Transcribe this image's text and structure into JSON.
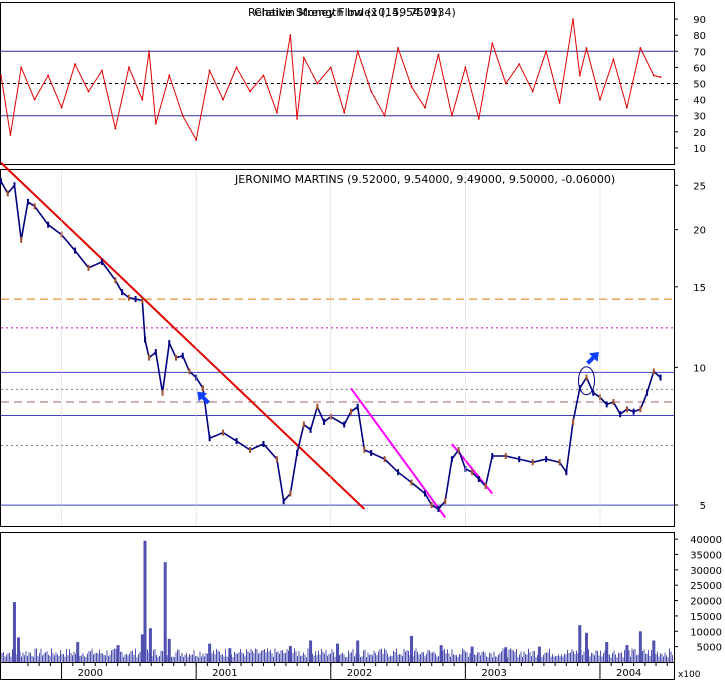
{
  "chart_data": [
    {
      "type": "line",
      "panel": "rsi",
      "title_overlay": [
        "Relative Strength Index (14, 54.7934)",
        "Chaikin Money Flow (10, 59.7501)"
      ],
      "ylim": [
        0,
        100
      ],
      "yticks": [
        10,
        20,
        30,
        40,
        50,
        60,
        70,
        80,
        90
      ],
      "levels": {
        "upper": 70,
        "middle": 50,
        "lower": 30
      },
      "series": [
        {
          "color": "#e00000",
          "x": [
            1999.55,
            1999.62,
            1999.7,
            1999.8,
            1999.9,
            2000.0,
            2000.1,
            2000.2,
            2000.3,
            2000.4,
            2000.5,
            2000.6,
            2000.65,
            2000.7,
            2000.8,
            2000.9,
            2001.0,
            2001.1,
            2001.2,
            2001.3,
            2001.4,
            2001.5,
            2001.6,
            2001.7,
            2001.75,
            2001.8,
            2001.9,
            2002.0,
            2002.1,
            2002.2,
            2002.3,
            2002.4,
            2002.5,
            2002.6,
            2002.7,
            2002.8,
            2002.9,
            2003.0,
            2003.1,
            2003.2,
            2003.3,
            2003.4,
            2003.5,
            2003.6,
            2003.7,
            2003.8,
            2003.85,
            2003.9,
            2004.0,
            2004.1,
            2004.2,
            2004.3,
            2004.4,
            2004.45
          ],
          "values": [
            55,
            18,
            60,
            40,
            55,
            35,
            62,
            45,
            58,
            22,
            60,
            40,
            70,
            25,
            55,
            30,
            15,
            58,
            40,
            60,
            45,
            55,
            32,
            80,
            28,
            66,
            50,
            60,
            32,
            70,
            45,
            30,
            72,
            48,
            35,
            68,
            30,
            60,
            28,
            75,
            50,
            62,
            45,
            70,
            38,
            90,
            55,
            72,
            40,
            65,
            35,
            72,
            55,
            54
          ]
        }
      ]
    },
    {
      "type": "line",
      "panel": "price",
      "title": "JERONIMO MARTINS (9.52000, 9.54000, 9.49000, 9.50000, -0.06000)",
      "scale": "log",
      "ylim": [
        4.5,
        27
      ],
      "yticks": [
        5,
        10,
        15,
        20,
        25
      ],
      "hlines": [
        {
          "y": 14.1,
          "style": "dashed",
          "color": "#e07a00"
        },
        {
          "y": 12.2,
          "style": "dotted",
          "color": "#c000c0"
        },
        {
          "y": 9.75,
          "style": "solid",
          "color": "#4040c0"
        },
        {
          "y": 8.95,
          "style": "dotted",
          "color": "#808080"
        },
        {
          "y": 8.4,
          "style": "dashed",
          "color": "#a06060"
        },
        {
          "y": 7.85,
          "style": "solid",
          "color": "#4040c0"
        },
        {
          "y": 6.75,
          "style": "dotted",
          "color": "#808080"
        },
        {
          "y": 5.0,
          "style": "solid",
          "color": "#4040c0"
        }
      ],
      "trendlines": [
        {
          "color": "#e00000",
          "from": [
            1999.55,
            28.0
          ],
          "to": [
            2002.25,
            4.9
          ]
        },
        {
          "color": "#ff00ff",
          "from": [
            2002.15,
            9.0
          ],
          "to": [
            2002.85,
            4.7
          ]
        },
        {
          "color": "#ff00ff",
          "from": [
            2002.9,
            6.8
          ],
          "to": [
            2003.2,
            5.3
          ]
        }
      ],
      "series": [
        {
          "color": "#000080",
          "x": [
            1999.55,
            1999.6,
            1999.65,
            1999.7,
            1999.75,
            1999.8,
            1999.9,
            2000.0,
            2000.1,
            2000.2,
            2000.3,
            2000.4,
            2000.45,
            2000.5,
            2000.55,
            2000.6,
            2000.62,
            2000.65,
            2000.7,
            2000.75,
            2000.8,
            2000.85,
            2000.9,
            2000.95,
            2001.0,
            2001.05,
            2001.1,
            2001.2,
            2001.3,
            2001.4,
            2001.5,
            2001.6,
            2001.65,
            2001.7,
            2001.75,
            2001.8,
            2001.85,
            2001.9,
            2001.95,
            2002.0,
            2002.1,
            2002.15,
            2002.2,
            2002.25,
            2002.3,
            2002.4,
            2002.5,
            2002.6,
            2002.7,
            2002.75,
            2002.8,
            2002.85,
            2002.9,
            2002.95,
            2003.0,
            2003.05,
            2003.1,
            2003.15,
            2003.2,
            2003.3,
            2003.4,
            2003.5,
            2003.6,
            2003.7,
            2003.75,
            2003.8,
            2003.85,
            2003.9,
            2003.95,
            2004.0,
            2004.05,
            2004.1,
            2004.15,
            2004.2,
            2004.25,
            2004.3,
            2004.35,
            2004.4,
            2004.45
          ],
          "values": [
            25.5,
            24.0,
            25.0,
            19.0,
            23.0,
            22.5,
            20.5,
            19.5,
            18.0,
            16.5,
            17.0,
            15.5,
            14.6,
            14.2,
            14.1,
            14.0,
            11.5,
            10.5,
            10.8,
            8.8,
            11.3,
            10.5,
            10.6,
            9.8,
            9.5,
            9.0,
            7.0,
            7.2,
            6.9,
            6.6,
            6.8,
            6.3,
            5.1,
            5.3,
            6.5,
            7.5,
            7.3,
            8.2,
            7.6,
            7.8,
            7.5,
            8.0,
            8.2,
            6.6,
            6.5,
            6.3,
            5.9,
            5.6,
            5.3,
            5.0,
            4.9,
            5.1,
            6.3,
            6.6,
            6.0,
            5.9,
            5.7,
            5.5,
            6.4,
            6.4,
            6.3,
            6.2,
            6.3,
            6.2,
            5.9,
            7.6,
            9.0,
            9.5,
            8.8,
            8.6,
            8.3,
            8.4,
            7.9,
            8.1,
            8.0,
            8.1,
            8.8,
            9.8,
            9.5
          ]
        }
      ],
      "annotations": [
        {
          "type": "arrow",
          "x": 2001.05,
          "y": 8.6,
          "color": "#1040ff"
        },
        {
          "type": "arrow",
          "x": 2003.95,
          "y": 10.5,
          "color": "#1040ff"
        },
        {
          "type": "ellipse",
          "x": 2003.9,
          "y": 9.35,
          "color": "#000080"
        }
      ]
    },
    {
      "type": "bar",
      "panel": "volume",
      "ylim": [
        0,
        42000
      ],
      "yticks": [
        5000,
        10000,
        15000,
        20000,
        25000,
        30000,
        35000,
        40000
      ],
      "ytick_labels": [
        "5000",
        "10000",
        "15000",
        "20000",
        "25000",
        "30000",
        "35000",
        "40000"
      ],
      "unit_label": "x100",
      "color": "#5050b0",
      "spikes": [
        {
          "x": 1999.65,
          "value": 19500
        },
        {
          "x": 1999.68,
          "value": 8000
        },
        {
          "x": 2000.12,
          "value": 6500
        },
        {
          "x": 2000.42,
          "value": 5500
        },
        {
          "x": 2000.6,
          "value": 9000
        },
        {
          "x": 2000.62,
          "value": 39500
        },
        {
          "x": 2000.66,
          "value": 11000
        },
        {
          "x": 2000.77,
          "value": 32500
        },
        {
          "x": 2000.8,
          "value": 7500
        },
        {
          "x": 2001.1,
          "value": 6000
        },
        {
          "x": 2001.25,
          "value": 4500
        },
        {
          "x": 2001.7,
          "value": 5200
        },
        {
          "x": 2001.85,
          "value": 7000
        },
        {
          "x": 2002.05,
          "value": 6000
        },
        {
          "x": 2002.2,
          "value": 7000
        },
        {
          "x": 2002.6,
          "value": 8500
        },
        {
          "x": 2002.82,
          "value": 5500
        },
        {
          "x": 2003.05,
          "value": 5000
        },
        {
          "x": 2003.3,
          "value": 4800
        },
        {
          "x": 2003.55,
          "value": 5000
        },
        {
          "x": 2003.85,
          "value": 12000
        },
        {
          "x": 2003.9,
          "value": 9500
        },
        {
          "x": 2004.05,
          "value": 6500
        },
        {
          "x": 2004.2,
          "value": 5500
        },
        {
          "x": 2004.3,
          "value": 10000
        },
        {
          "x": 2004.4,
          "value": 7000
        }
      ]
    }
  ],
  "x_axis": {
    "xlim": [
      1999.55,
      2004.55
    ],
    "ticks": [
      {
        "x": 2000,
        "label": "2000"
      },
      {
        "x": 2001,
        "label": "2001"
      },
      {
        "x": 2002,
        "label": "2002"
      },
      {
        "x": 2003,
        "label": "2003"
      },
      {
        "x": 2004,
        "label": "2004"
      }
    ]
  }
}
